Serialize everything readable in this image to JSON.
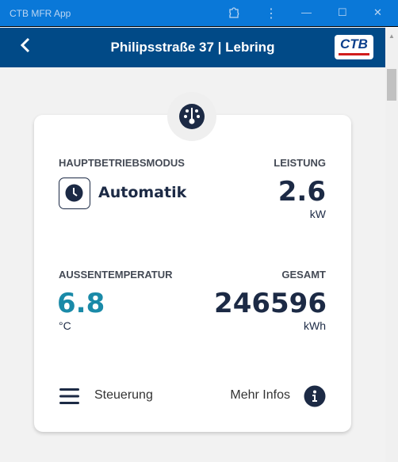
{
  "window": {
    "title": "CTB MFR App"
  },
  "header": {
    "title": "Philipsstraße  37 | Lebring",
    "logo_text": "CTB"
  },
  "card": {
    "mode_label": "HAUPTBETRIEBSMODUS",
    "mode_value": "Automatik",
    "power_label": "LEISTUNG",
    "power_value": "2.6",
    "power_unit": "kW",
    "temp_label": "AUSSENTEMPERATUR",
    "temp_value": "6.8",
    "temp_unit": "°C",
    "total_label": "GESAMT",
    "total_value": "246596",
    "total_unit": "kWh",
    "control_label": "Steuerung",
    "info_label": "Mehr Infos"
  },
  "colors": {
    "titlebar": "#0a78d8",
    "header": "#014a87",
    "dark": "#1c2a45",
    "temp": "#1a8aa8"
  }
}
